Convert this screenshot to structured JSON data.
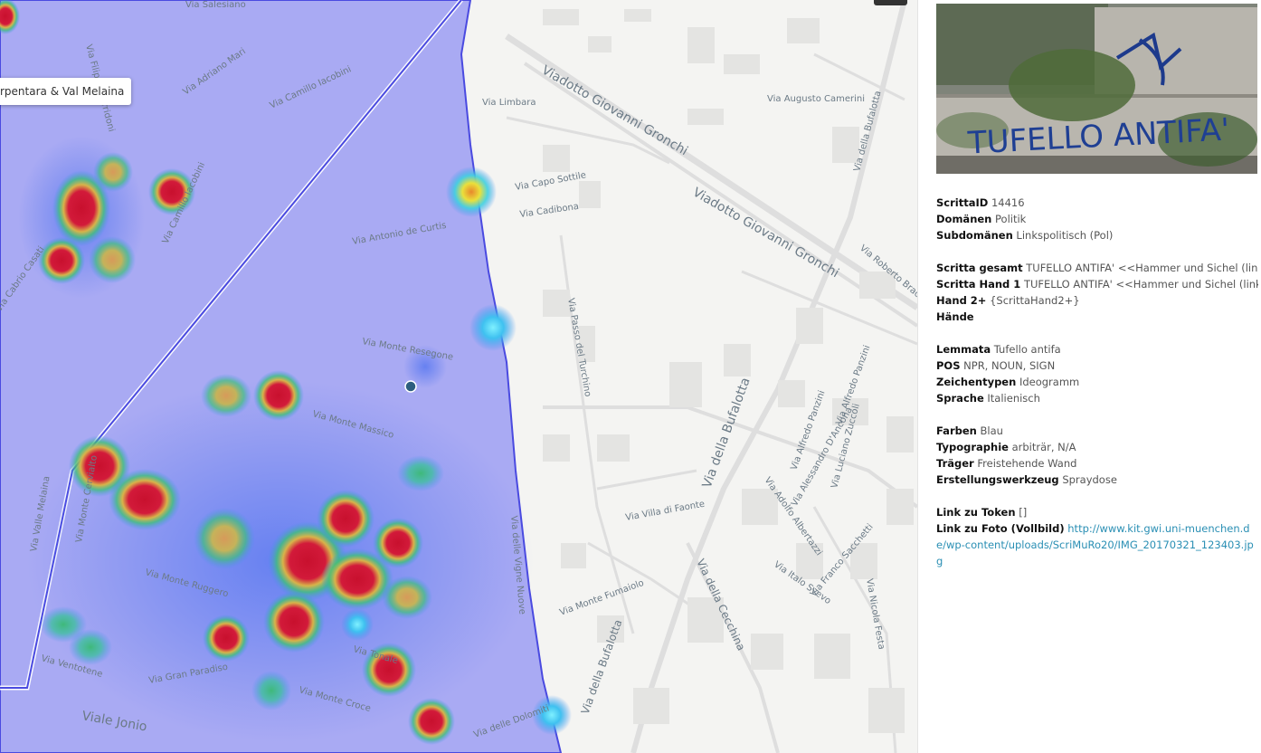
{
  "map": {
    "tooltip": "rpentara & Val Melaina",
    "streets": [
      "Via Salesiano",
      "Via Filippo Corridoni",
      "Via Adriano Mari",
      "Via Camillo Iacobini",
      "Via Camillo Iacobini",
      "Via Cabrio Casati",
      "Via Limbara",
      "Via Capo Sottile",
      "Via Cadibona",
      "Viadotto Giovanni Gronchi",
      "Viadotto Giovanni Gronchi",
      "Via Augusto Camerini",
      "Via della Bufalotta",
      "Via Roberto Bracco",
      "Via Antonio de Curtis",
      "Via Monte Resegone",
      "Via Monte Massico",
      "Via Passo del Turchino",
      "Via della Bufalotta",
      "Via Alfredo Panzini",
      "Via Alfredo Panzini",
      "Via Adolfo Albertazzi",
      "Via Alessandro D'Ancona",
      "Via Luciano Zuccoli",
      "Via Villa di Faonte",
      "Via della Cecchina",
      "Via Italo Svevo",
      "Via Franco Sacchetti",
      "Via Nicola Festa",
      "Via Monte Fumaiolo",
      "Via della Bufalotta",
      "Via Monte Ruggero",
      "Via Gran Paradiso",
      "Via Monte Croce",
      "Viale Jonio",
      "Via delle Dolomiti",
      "Via delle Vigne Nuove",
      "Via Ventotene",
      "Via Tonale",
      "Via Valle Melaina",
      "Via Monte Cervialto"
    ],
    "colors": {
      "polygon_fill": "#7b7cf3",
      "polygon_stroke": "#4a4ae0",
      "heat_hot": "#c8102e",
      "heat_warm": "#e9e243",
      "heat_cool": "#3fc1f0"
    }
  },
  "panel": {
    "photo_alt": "Graffiti on wall: TUFELLO ANTIFA with hammer and sickle",
    "photo_text": "TUFELLO ANTIFA'",
    "fields": {
      "scritta_id_label": "ScrittaID",
      "scritta_id": "14416",
      "domaenen_label": "Domänen",
      "domaenen": "Politik",
      "subdomaenen_label": "Subdomänen",
      "subdomaenen": "Linkspolitisch (Pol)",
      "gesamt_label": "Scritta gesamt",
      "gesamt": "TUFELLO ANTIFA' <<Hammer und Sichel (links)>>",
      "hand1_label": "Scritta Hand 1",
      "hand1": "TUFELLO ANTIFA' <<Hammer und Sichel (links)>>",
      "hand2_label": "Hand 2+",
      "hand2": "{ScrittaHand2+}",
      "haende_label": "Hände",
      "haende": "",
      "lemmata_label": "Lemmata",
      "lemmata": "Tufello antifa",
      "pos_label": "POS",
      "pos": "NPR, NOUN, SIGN",
      "zeichentypen_label": "Zeichentypen",
      "zeichentypen": "Ideogramm",
      "sprache_label": "Sprache",
      "sprache": "Italienisch",
      "farben_label": "Farben",
      "farben": "Blau",
      "typographie_label": "Typographie",
      "typographie": "arbiträr, N/A",
      "traeger_label": "Träger",
      "traeger": "Freistehende Wand",
      "werkzeug_label": "Erstellungswerkzeug",
      "werkzeug": "Spraydose",
      "token_label": "Link zu Token",
      "token": "[]",
      "foto_label": "Link zu Foto (Vollbild)",
      "foto": "http://www.kit.gwi.uni-muenchen.de/wp-content/uploads/ScriMuRo20/IMG_20170321_123403.jpg"
    }
  }
}
